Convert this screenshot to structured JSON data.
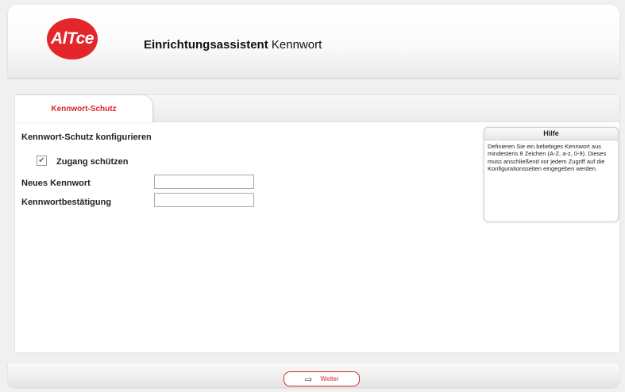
{
  "header": {
    "logo_text": "AlTce",
    "title_bold": "Einrichtungsassistent",
    "title_rest": "Kennwort"
  },
  "tabs": [
    {
      "label": "Kennwort-Schutz",
      "active": true
    }
  ],
  "form": {
    "section_title": "Kennwort-Schutz konfigurieren",
    "checkbox_label": "Zugang schützen",
    "checkbox_checked": true,
    "new_password_label": "Neues Kennwort",
    "new_password_value": "",
    "confirm_label": "Kennwortbestätigung",
    "confirm_value": ""
  },
  "help": {
    "title": "Hilfe",
    "text": "Definieren Sie ein beliebiges Kennwort aus mindestens 8 Zeichen (A-Z, a-z, 0-9). Dieses muss anschließend vor jedem Zugriff auf die Konfigurationsseiten eingegeben werden."
  },
  "footer": {
    "next_label": "Weiter",
    "next_icon": "arrow-right-icon"
  },
  "colors": {
    "brand_red": "#e2262a",
    "tab_text": "#d7262b"
  }
}
